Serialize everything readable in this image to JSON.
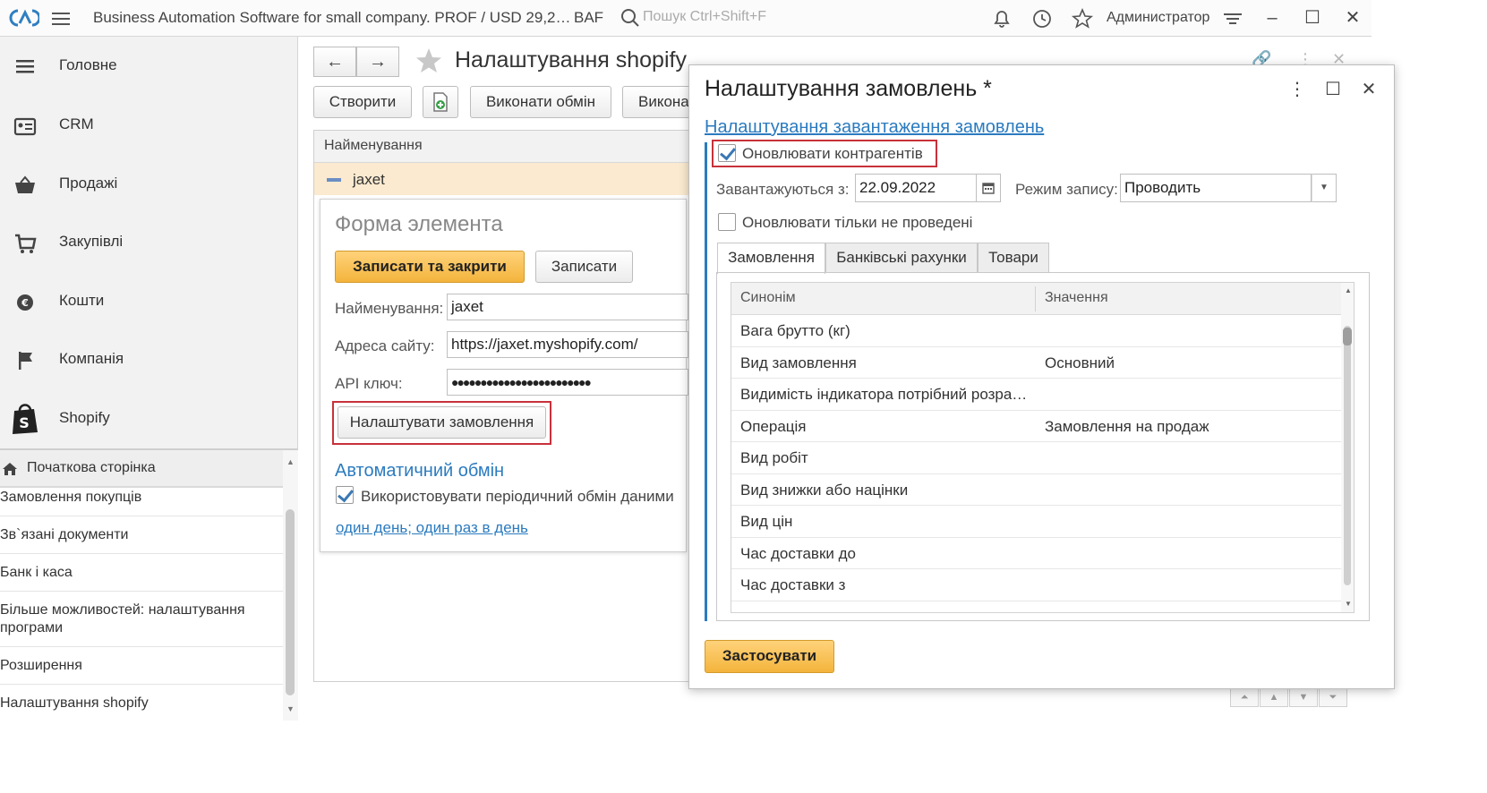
{
  "topbar": {
    "app_title": "Business Automation Software for small company. PROF / USD 29,2…",
    "app_short": "BAF",
    "search_placeholder": "Пошук Ctrl+Shift+F",
    "user": "Администратор",
    "icons": [
      "logo-icon",
      "menu-icon",
      "search-icon",
      "bell-icon",
      "history-icon",
      "star-icon",
      "settings-icon",
      "minimize-icon",
      "maximize-icon",
      "close-icon"
    ]
  },
  "sidebar": {
    "items": [
      {
        "label": "Головне",
        "icon": "menu-lines-icon"
      },
      {
        "label": "CRM",
        "icon": "contact-card-icon"
      },
      {
        "label": "Продажі",
        "icon": "basket-icon"
      },
      {
        "label": "Закупівлі",
        "icon": "cart-icon"
      },
      {
        "label": "Кошти",
        "icon": "coin-icon"
      },
      {
        "label": "Компанія",
        "icon": "flag-icon"
      },
      {
        "label": "Shopify",
        "icon": "shopify-bag-icon"
      }
    ]
  },
  "open_windows": {
    "home": "Початкова сторінка",
    "items": [
      "Замовлення покупців",
      "Зв`язані документи",
      "Банк і каса",
      "Більше можливостей: налаштування програми",
      "Розширення",
      "Налаштування shopify"
    ]
  },
  "main": {
    "title": "Налаштування shopify",
    "buttons": {
      "create": "Створити",
      "exchange": "Виконати обмін",
      "exchange_cut": "Викона"
    },
    "list": {
      "header": "Найменування",
      "rows": [
        "jaxet"
      ]
    },
    "element_form": {
      "title": "Форма элемента",
      "save_close": "Записати та закрити",
      "save": "Записати",
      "name_label": "Найменування:",
      "name_value": "jaxet",
      "site_label": "Адреса сайту:",
      "site_value": "https://jaxet.myshopify.com/",
      "api_label": "API ключ:",
      "api_value": "●●●●●●●●●●●●●●●●●●●●●●●●",
      "configure_orders": "Налаштувати замовлення",
      "auto_exchange_title": "Автоматичний обмін",
      "use_periodic": "Використовувати періодичний обмін даними",
      "use_periodic_checked": true,
      "schedule_link": "один день; один раз в день"
    }
  },
  "dialog": {
    "title": "Налаштування замовлень *",
    "group_title": "Налаштування завантаження замовлень",
    "update_contractors": "Оновлювати контрагентів",
    "update_contractors_checked": true,
    "loaded_from_label": "Завантажуються з:",
    "loaded_from_value": "22.09.2022",
    "write_mode_label": "Режим запису:",
    "write_mode_value": "Проводить",
    "update_only_unposted": "Оновлювати тільки не проведені",
    "update_only_unposted_checked": false,
    "tabs": [
      "Замовлення",
      "Банківські рахунки",
      "Товари"
    ],
    "active_tab": 0,
    "grid": {
      "columns": [
        "Синонім",
        "Значення"
      ],
      "rows": [
        {
          "synonym": "Вага брутто (кг)",
          "value": ""
        },
        {
          "synonym": "Вид замовлення",
          "value": "Основний"
        },
        {
          "synonym": "Видимість індикатора потрібний розра…",
          "value": ""
        },
        {
          "synonym": "Операція",
          "value": "Замовлення на продаж"
        },
        {
          "synonym": "Вид робіт",
          "value": ""
        },
        {
          "synonym": "Вид знижки або націнки",
          "value": ""
        },
        {
          "synonym": "Вид цін",
          "value": ""
        },
        {
          "synonym": "Час доставки до",
          "value": ""
        },
        {
          "synonym": "Час доставки з",
          "value": ""
        }
      ]
    },
    "apply": "Застосувати"
  },
  "colors": {
    "accent": "#2b7bbf",
    "primary_button": "#f3b43c",
    "highlight_box": "#c8313a",
    "selected_row": "#fbead0"
  }
}
